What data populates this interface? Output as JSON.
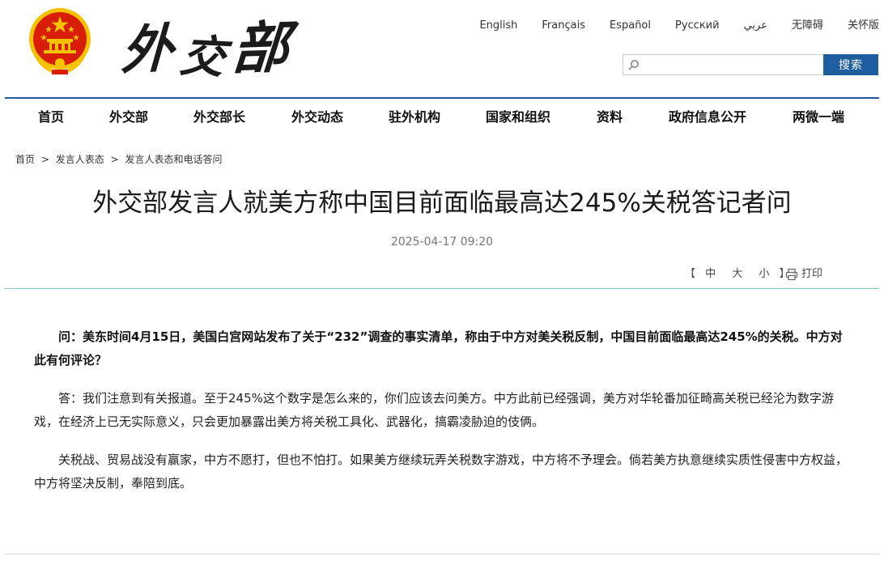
{
  "header": {
    "logo_text": [
      "外",
      "交",
      "部"
    ],
    "languages": [
      "English",
      "Français",
      "Español",
      "Русский",
      "عربي",
      "无障碍",
      "关怀版"
    ],
    "search": {
      "placeholder": "",
      "button_label": "搜索"
    },
    "colors": {
      "brand_blue": "#1f5e9e",
      "emblem_red": "#d81e06",
      "emblem_gold": "#f5c200"
    }
  },
  "nav": {
    "items": [
      "首页",
      "外交部",
      "外交部长",
      "外交动态",
      "驻外机构",
      "国家和组织",
      "资料",
      "政府信息公开",
      "两微一端"
    ]
  },
  "breadcrumb": {
    "items": [
      "首页",
      "发言人表态",
      "发言人表态和电话答问"
    ],
    "separator": ">"
  },
  "article": {
    "title": "外交部发言人就美方称中国目前面临最高达245%关税答记者问",
    "date": "2025-04-17 09:20",
    "tools": {
      "open_bracket": "【",
      "close_bracket": "】",
      "size_large": "中",
      "size_medium": "大",
      "size_small": "小",
      "print_label": "打印"
    },
    "paragraphs": [
      "问：美东时间4月15日，美国白宫网站发布了关于“232”调查的事实清单，称由于中方对美关税反制，中国目前面临最高达245%的关税。中方对此有何评论？",
      "答：我们注意到有关报道。至于245%这个数字是怎么来的，你们应该去问美方。中方此前已经强调，美方对华轮番加征畸高关税已经沦为数字游戏，在经济上已无实际意义，只会更加暴露出美方将关税工具化、武器化，搞霸凌胁迫的伎俩。",
      "关税战、贸易战没有赢家，中方不愿打，但也不怕打。如果美方继续玩弄关税数字游戏，中方将不予理会。倘若美方执意继续实质性侵害中方权益，中方将坚决反制，奉陪到底。"
    ]
  }
}
